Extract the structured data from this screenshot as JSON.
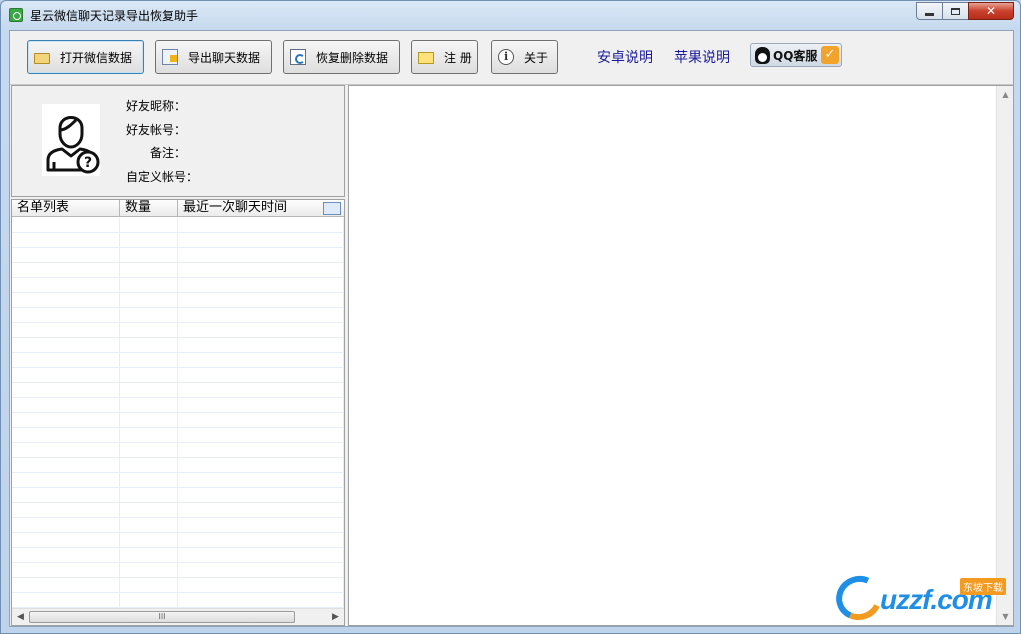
{
  "window": {
    "title": "星云微信聊天记录导出恢复助手"
  },
  "toolbar": {
    "open_label": "打开微信数据",
    "export_label": "导出聊天数据",
    "restore_label": "恢复删除数据",
    "register_label": "注 册",
    "about_label": "关于"
  },
  "links": {
    "android": "安卓说明",
    "apple": "苹果说明"
  },
  "qq_service": {
    "label": "QQ客服"
  },
  "profile": {
    "nickname_label": "好友昵称：",
    "account_label": "好友帐号：",
    "remark_label": "备注：",
    "custom_account_label": "自定义帐号："
  },
  "list": {
    "columns": [
      "名单列表",
      "数量",
      "最近一次聊天时间"
    ]
  },
  "scrollbar": {
    "grip": "III"
  },
  "watermark": {
    "brand": "uzzf.com",
    "badge": "东坡下载"
  },
  "colors": {
    "link": "#1b1b9c",
    "window_frame": "#bfd3ea",
    "close_button": "#c9402d"
  }
}
